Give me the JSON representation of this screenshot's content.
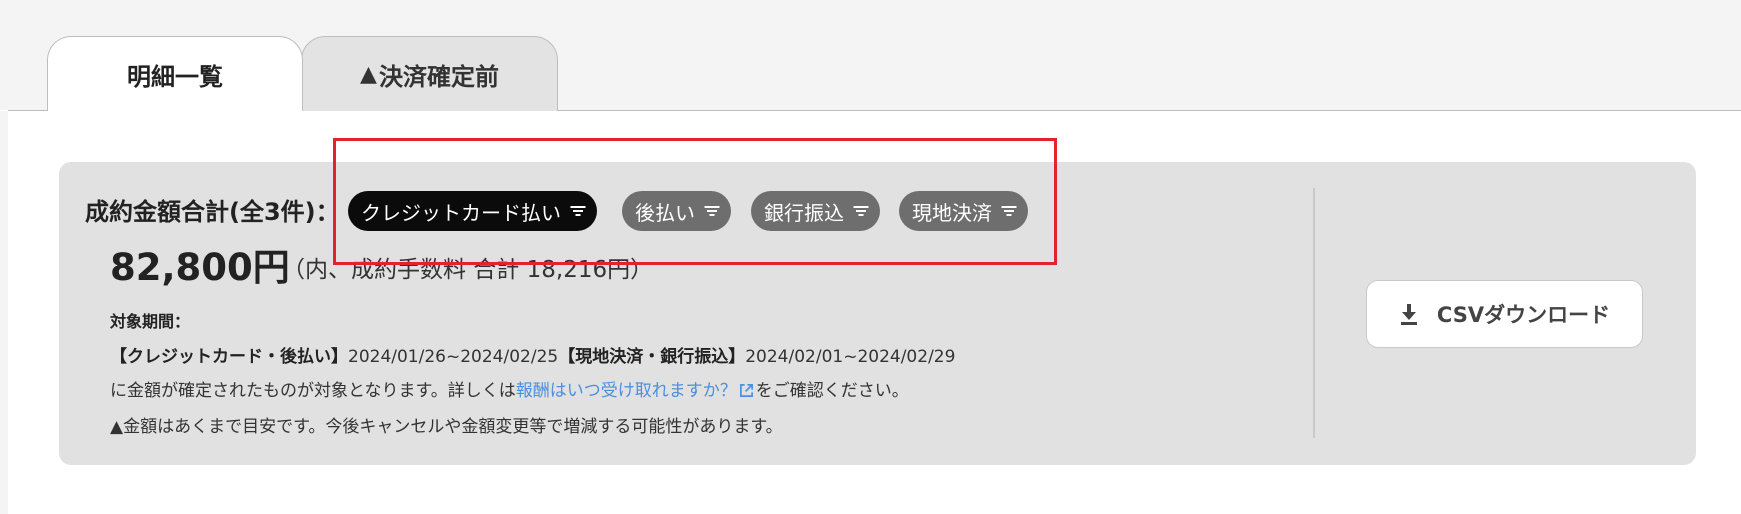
{
  "tabs": {
    "active_label": "明細一覧",
    "inactive_label": "決済確定前",
    "inactive_warning_icon": "warning-icon"
  },
  "summary": {
    "total_label": "成約金額合計(全3件)：",
    "amount": "82,800円",
    "fee_note": "（内、成約手数料 合計 18,216円）"
  },
  "filters": [
    {
      "label": "クレジットカード払い",
      "selected": true,
      "icon": "filter-icon"
    },
    {
      "label": "後払い",
      "selected": false,
      "icon": "filter-icon"
    },
    {
      "label": "銀行振込",
      "selected": false,
      "icon": "filter-icon"
    },
    {
      "label": "現地決済",
      "selected": false,
      "icon": "filter-icon"
    }
  ],
  "period": {
    "title": "対象期間：",
    "group1_label": "【クレジットカード・後払い】",
    "group1_range": "2024/01/26~2024/02/25",
    "group2_label": "【現地決済・銀行振込】",
    "group2_range": "2024/02/01~2024/02/29",
    "note_prefix": "に金額が確定されたものが対象となります。詳しくは",
    "link_text": "報酬はいつ受け取れますか？",
    "note_suffix": "をご確認ください。",
    "warning_text": "金額はあくまで目安です。今後キャンセルや金額変更等で増減する可能性があります。"
  },
  "csv_button": {
    "label": "CSVダウンロード",
    "icon": "download-icon"
  },
  "colors": {
    "panel_bg": "#e1e1e1",
    "chip_selected": "#0b0b0b",
    "chip_unselected": "#6e6e6e",
    "link": "#4a8fe0",
    "highlight": "#e2232e"
  }
}
